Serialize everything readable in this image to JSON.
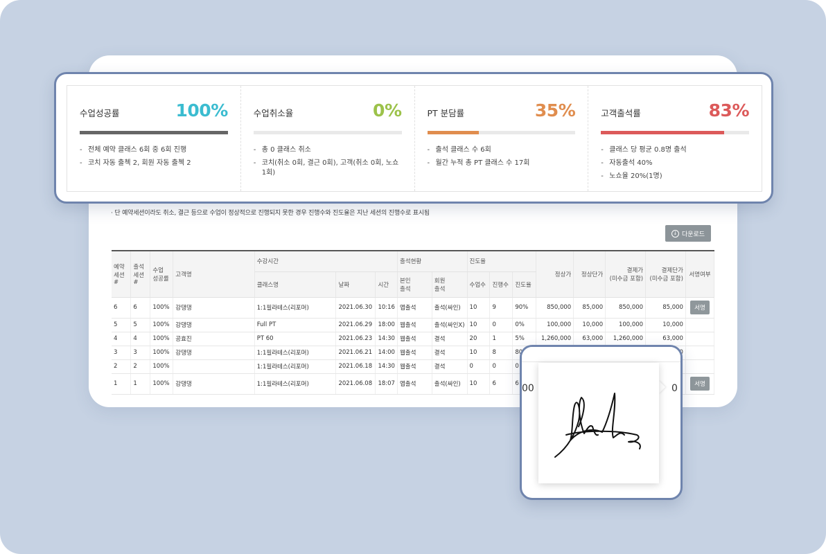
{
  "colors": {
    "success": "#3bbcd0",
    "cancel": "#9cc24a",
    "pt_share": "#e08d4e",
    "attendance": "#dc5a5a",
    "success_bar": "#666666"
  },
  "stats": [
    {
      "label": "수업성공률",
      "value": "100%",
      "progress": 1.0,
      "bullets": [
        "전체 예약 클래스 6회 중 6회 진행",
        "코치 자동 출첵 2, 회원 자동 출첵 2"
      ]
    },
    {
      "label": "수업취소율",
      "value": "0%",
      "progress": 0.0,
      "bullets": [
        "총 0 클래스 취소",
        "코치(취소 0회, 결근 0회), 고객(취소 0회, 노쇼 1회)"
      ]
    },
    {
      "label": "PT 분담률",
      "value": "35%",
      "progress": 0.35,
      "bullets": [
        "출석 클래스 수 6회",
        "월간 누적 총 PT 클래스 수 17회"
      ]
    },
    {
      "label": "고객출석률",
      "value": "83%",
      "progress": 0.83,
      "bullets": [
        "클래스 당 평균 0.8명 출석",
        "자동출석 40%",
        "노쇼율 20%(1명)"
      ]
    }
  ],
  "note": "·   단 예약세션이라도 취소, 결근 등으로 수업이 정상적으로 진행되지 못한 경우 진행수와 진도율은 지난 세션의 진행수로 표시됨",
  "download_label": "다운로드",
  "table": {
    "groups": {
      "time": "수강시간",
      "attendance": "출석현황",
      "progress": "진도율"
    },
    "headers": {
      "reserve_no": "예약\n세션#",
      "attend_no": "출석\n세션#",
      "success": "수업\n성공률",
      "customer": "고객명",
      "class_name": "클래스명",
      "date": "날짜",
      "time": "시간",
      "self_attend": "본인\n출석",
      "member_attend": "회원\n출석",
      "lessons": "수업수",
      "done": "진행수",
      "rate": "진도율",
      "regular_price": "정상가",
      "regular_unit": "정상단가",
      "paid_price": "결제가\n(미수금 포함)",
      "paid_unit": "결제단가\n(미수금 포함)",
      "signed": "서명여부"
    },
    "sign_label": "서명",
    "rows": [
      {
        "reserve": "6",
        "attend": "6",
        "success": "100%",
        "customer": "강댕댕",
        "class_name": "1:1필라테스(리포머)",
        "date": "2021.06.30",
        "time": "10:16",
        "self": "앱출석",
        "member": "출석(싸인)",
        "lessons": "10",
        "done": "9",
        "rate": "90%",
        "rp": "850,000",
        "ru": "85,000",
        "pp": "850,000",
        "pu": "85,000",
        "sign": true
      },
      {
        "reserve": "5",
        "attend": "5",
        "success": "100%",
        "customer": "강댕댕",
        "class_name": "Full PT",
        "date": "2021.06.29",
        "time": "18:00",
        "self": "웹출석",
        "member": "출석(싸인X)",
        "lessons": "10",
        "done": "0",
        "rate": "0%",
        "rp": "100,000",
        "ru": "10,000",
        "pp": "100,000",
        "pu": "10,000",
        "sign": false
      },
      {
        "reserve": "4",
        "attend": "4",
        "success": "100%",
        "customer": "공효진",
        "class_name": "PT 60",
        "date": "2021.06.23",
        "time": "14:30",
        "self": "웹출석",
        "member": "결석",
        "lessons": "20",
        "done": "1",
        "rate": "5%",
        "rp": "1,260,000",
        "ru": "63,000",
        "pp": "1,260,000",
        "pu": "63,000",
        "sign": false
      },
      {
        "reserve": "3",
        "attend": "3",
        "success": "100%",
        "customer": "강댕댕",
        "class_name": "1:1필라테스(리포머)",
        "date": "2021.06.21",
        "time": "14:00",
        "self": "웹출석",
        "member": "결석",
        "lessons": "10",
        "done": "8",
        "rate": "80",
        "rp": "",
        "ru": "",
        "pp": "",
        "pu": "0",
        "sign": false
      },
      {
        "reserve": "2",
        "attend": "2",
        "success": "100%",
        "customer": "",
        "class_name": "1:1필라테스(리포머)",
        "date": "2021.06.18",
        "time": "14:30",
        "self": "웹출석",
        "member": "결석",
        "lessons": "0",
        "done": "0",
        "rate": "0",
        "rp": "",
        "ru": "",
        "pp": "",
        "pu": "",
        "sign": false
      },
      {
        "reserve": "1",
        "attend": "1",
        "success": "100%",
        "customer": "강댕댕",
        "class_name": "1:1필라테스(리포머)",
        "date": "2021.06.08",
        "time": "18:07",
        "self": "앱출석",
        "member": "출석(싸인)",
        "lessons": "10",
        "done": "6",
        "rate": "6",
        "rp": "",
        "ru": "",
        "pp": "",
        "pu": "",
        "sign": true
      }
    ]
  },
  "signature_popup": {
    "left_fragment": "00",
    "right_fragment": "0"
  }
}
